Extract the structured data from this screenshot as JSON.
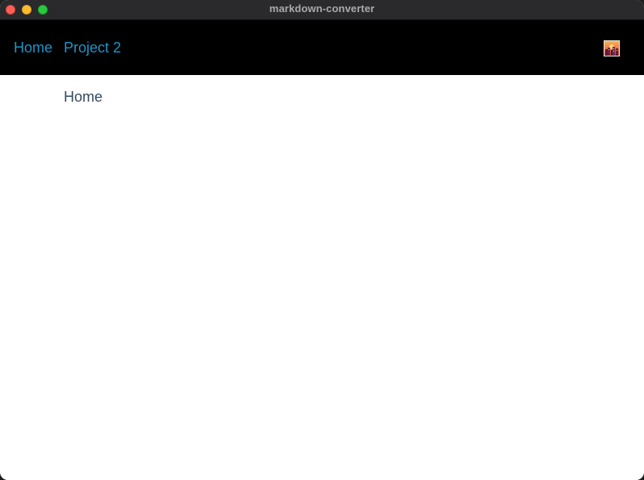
{
  "window": {
    "title": "markdown-converter"
  },
  "navbar": {
    "links": [
      {
        "label": "Home"
      },
      {
        "label": "Project 2"
      }
    ],
    "app_icon": "sunset-city-image-icon",
    "link_color": "#1a95c8",
    "background": "#000000"
  },
  "main": {
    "heading": "Home",
    "heading_color": "#34495e"
  }
}
